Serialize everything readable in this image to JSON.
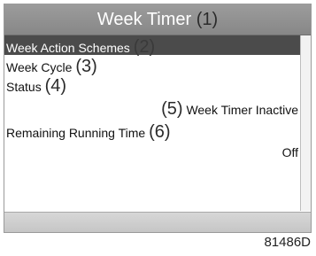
{
  "header": {
    "title": "Week Timer",
    "num": "(1)"
  },
  "menu": [
    {
      "label": "Week Action Schemes",
      "num": "(2)"
    },
    {
      "label": "Week Cycle",
      "num": "(3)"
    },
    {
      "label": "Status",
      "num": "(4)",
      "value_num": "(5)",
      "value": "Week Timer Inactive"
    },
    {
      "label": "Remaining Running Time",
      "num": "(6)",
      "value": "Off"
    }
  ],
  "figure_code": "81486D"
}
